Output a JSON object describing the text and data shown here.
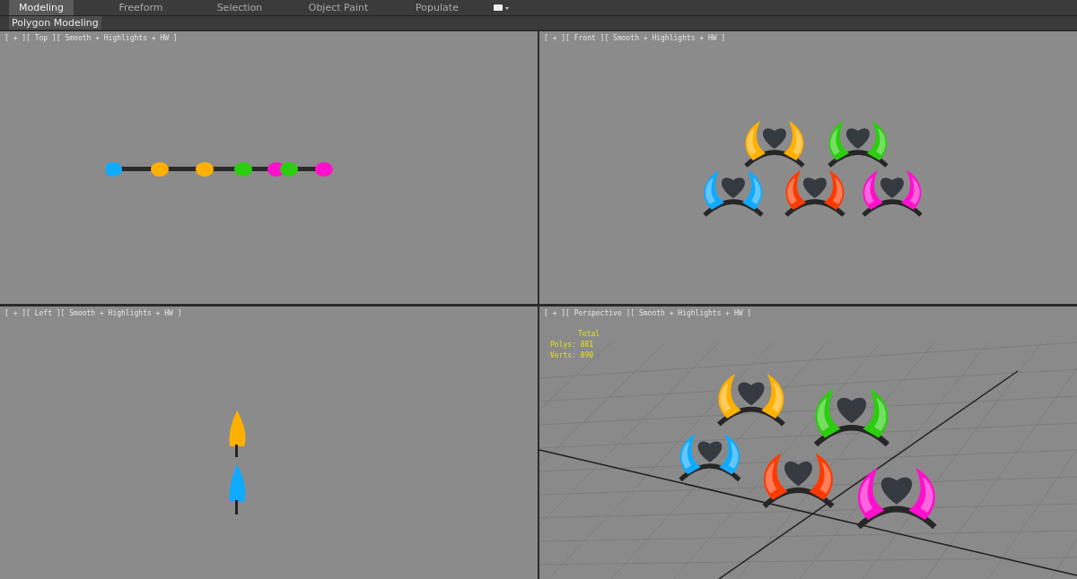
{
  "ribbon_tabs": [
    {
      "label": "Modeling",
      "selected": true
    },
    {
      "label": "Freeform",
      "selected": false
    },
    {
      "label": "Selection",
      "selected": false
    },
    {
      "label": "Object Paint",
      "selected": false
    },
    {
      "label": "Populate",
      "selected": false
    }
  ],
  "ribbon_panel": {
    "label": "Polygon Modeling"
  },
  "viewports": [
    {
      "kind": "top",
      "label": "[ + ][ Top ][ Smooth + Highlights + HW ]"
    },
    {
      "kind": "front",
      "label": "[ + ][ Front ][ Smooth + Highlights + HW ]"
    },
    {
      "kind": "left",
      "label": "[ + ][ Left ][ Smooth + Highlights + HW ]"
    },
    {
      "kind": "perspective",
      "label": "[ + ][ Perspective ][ Smooth + Highlights + HW ]",
      "stats": {
        "title": "Total",
        "lines": [
          "Polys: 881",
          "Verts: 890"
        ]
      }
    }
  ]
}
